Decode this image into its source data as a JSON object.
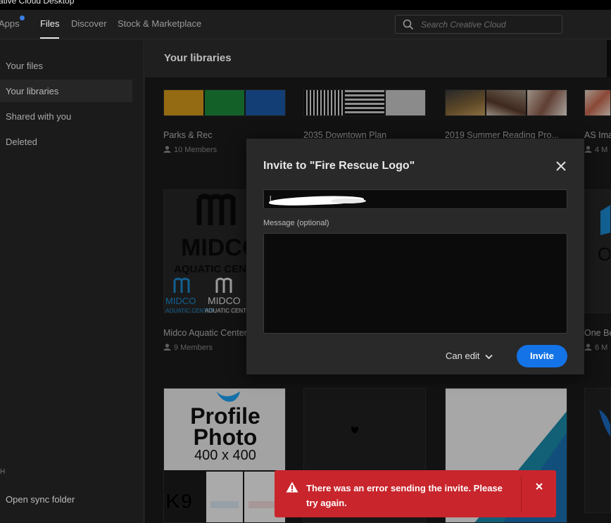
{
  "window": {
    "title": "ative Cloud Desktop"
  },
  "topnav": {
    "tabs": [
      {
        "label": "Apps"
      },
      {
        "label": "Files"
      },
      {
        "label": "Discover"
      },
      {
        "label": "Stock & Marketplace"
      }
    ],
    "active_tab": "Files",
    "search_placeholder": "Search Creative Cloud"
  },
  "sidebar": {
    "items": [
      {
        "label": "Your files"
      },
      {
        "label": "Your libraries"
      },
      {
        "label": "Shared with you"
      },
      {
        "label": "Deleted"
      }
    ],
    "selected": "Your libraries",
    "section_label": "H",
    "open_sync_folder": "Open sync folder"
  },
  "main": {
    "header": "Your libraries",
    "libraries": [
      {
        "name": "Parks & Rec",
        "members": "10 Members"
      },
      {
        "name": "2035 Downtown Plan",
        "members": ""
      },
      {
        "name": "2019 Summer Reading Pro...",
        "members": ""
      },
      {
        "name": "AS Ima",
        "members": "4 M"
      },
      {
        "name": "Midco Aquatic Center",
        "members": "9 Members"
      },
      {
        "name": "One Be",
        "members": "6 M"
      }
    ],
    "midco": {
      "big": "MIDCO",
      "sub": "AQUATIC CENTER",
      "small": "MIDCO",
      "small_sub": "AQUATIC CENTER"
    },
    "profile": {
      "line1": "Profile",
      "line2": "Photo",
      "line3": "400 x 400",
      "k9": "K9"
    },
    "right_partial_letter": "O",
    "colors": {
      "yellow": "#d49a1a",
      "green": "#1e8a3c",
      "blue": "#1a5aa8"
    }
  },
  "modal": {
    "title": "Invite to \"Fire Rescue Logo\"",
    "email_value": "l",
    "message_label": "Message (optional)",
    "permission": "Can edit",
    "invite_label": "Invite",
    "accent": "#1473e6"
  },
  "toast": {
    "message": "There was an error sending the invite. Please try again.",
    "color": "#c9252c"
  }
}
